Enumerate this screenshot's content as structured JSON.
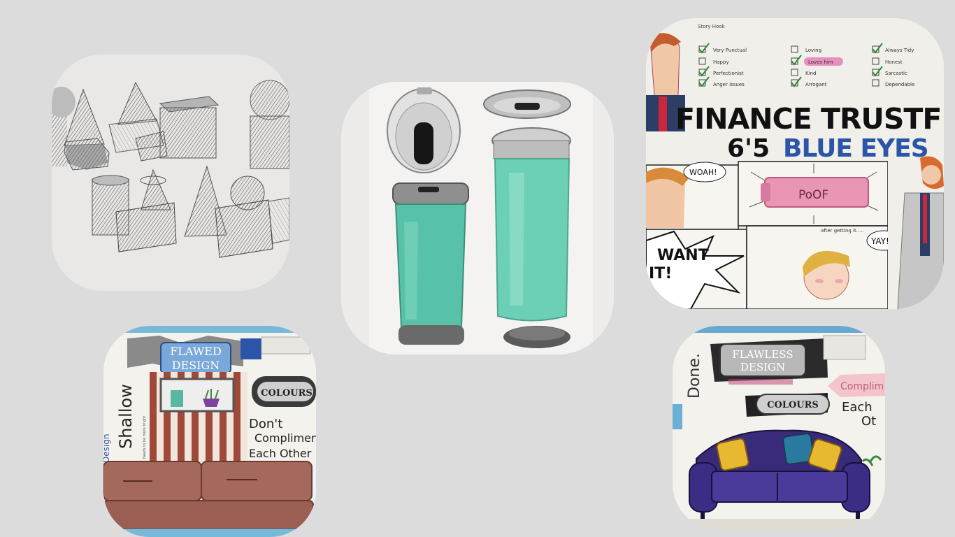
{
  "tiles": {
    "shapes": {},
    "cups": {},
    "character": {
      "header": "Story Hook",
      "traits": [
        [
          "Very Punctual",
          "Happy",
          "Perfectionist",
          "Anger Issues"
        ],
        [
          "Loving",
          "Loves him",
          "Kind",
          "Arrogant"
        ],
        [
          "Always Tidy",
          "Honest",
          "Sarcastic",
          "Dependable"
        ]
      ],
      "title_line1": "FINANCE TRUSTFU",
      "title_line2_a": "6'5",
      "title_line2_b": "BLUE EYES",
      "bubble_woah": "WOAH!",
      "bottle_label": "PoOF",
      "want_text_1": "WANT",
      "want_text_2": "IT!",
      "caption_after": "after getting it.....",
      "bubble_yay": "YAY!"
    },
    "flawed": {
      "title_line1": "FLAWED",
      "title_line2": "DESIGN",
      "label_colours": "COLOURS",
      "side_word": "Shallow",
      "side_word_small": "Design",
      "note_1": "Don't",
      "note_2": "Compliment",
      "note_3": "Each Other",
      "tiny_note": "Needs to be more bright"
    },
    "flawless": {
      "title_line1": "FLAWLESS",
      "title_line2": "DESIGN",
      "label_colours": "COLOURS",
      "side_word": "Done.",
      "pink_note": "Complim",
      "note_1": "Each",
      "note_2": "Ot"
    }
  },
  "colors": {
    "background": "#dcdcdc",
    "teal": "#58c2a8",
    "blue_text": "#2b55a8",
    "pink": "#e07b9a",
    "sofa_purple": "#3a2a7a",
    "sofa_brown": "#a0665a",
    "cushion_yellow": "#e8b830"
  }
}
